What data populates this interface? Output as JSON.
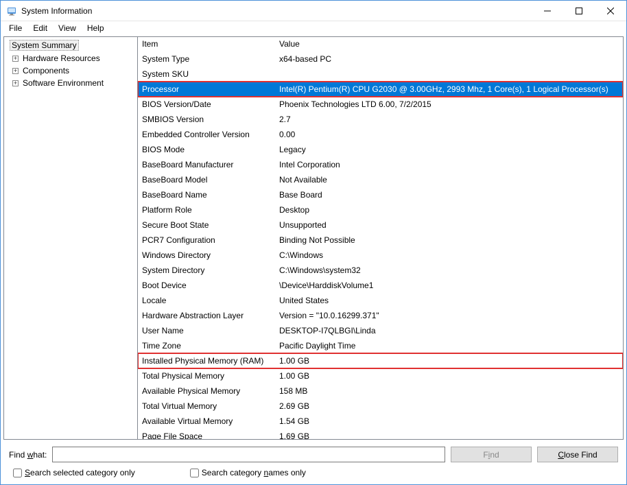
{
  "window": {
    "title": "System Information"
  },
  "menu": {
    "file": "File",
    "edit": "Edit",
    "view": "View",
    "help": "Help"
  },
  "tree": {
    "summary": "System Summary",
    "hardware": "Hardware Resources",
    "components": "Components",
    "software": "Software Environment"
  },
  "list": {
    "header_item": "Item",
    "header_value": "Value",
    "rows": [
      {
        "item": "System Type",
        "value": "x64-based PC"
      },
      {
        "item": "System SKU",
        "value": ""
      },
      {
        "item": "Processor",
        "value": "Intel(R) Pentium(R) CPU G2030 @ 3.00GHz, 2993 Mhz, 1 Core(s), 1 Logical Processor(s)"
      },
      {
        "item": "BIOS Version/Date",
        "value": "Phoenix Technologies LTD 6.00, 7/2/2015"
      },
      {
        "item": "SMBIOS Version",
        "value": "2.7"
      },
      {
        "item": "Embedded Controller Version",
        "value": "0.00"
      },
      {
        "item": "BIOS Mode",
        "value": "Legacy"
      },
      {
        "item": "BaseBoard Manufacturer",
        "value": "Intel Corporation"
      },
      {
        "item": "BaseBoard Model",
        "value": "Not Available"
      },
      {
        "item": "BaseBoard Name",
        "value": "Base Board"
      },
      {
        "item": "Platform Role",
        "value": "Desktop"
      },
      {
        "item": "Secure Boot State",
        "value": "Unsupported"
      },
      {
        "item": "PCR7 Configuration",
        "value": "Binding Not Possible"
      },
      {
        "item": "Windows Directory",
        "value": "C:\\Windows"
      },
      {
        "item": "System Directory",
        "value": "C:\\Windows\\system32"
      },
      {
        "item": "Boot Device",
        "value": "\\Device\\HarddiskVolume1"
      },
      {
        "item": "Locale",
        "value": "United States"
      },
      {
        "item": "Hardware Abstraction Layer",
        "value": "Version = \"10.0.16299.371\""
      },
      {
        "item": "User Name",
        "value": "DESKTOP-I7QLBGI\\Linda"
      },
      {
        "item": "Time Zone",
        "value": "Pacific Daylight Time"
      },
      {
        "item": "Installed Physical Memory (RAM)",
        "value": "1.00 GB"
      },
      {
        "item": "Total Physical Memory",
        "value": "1.00 GB"
      },
      {
        "item": "Available Physical Memory",
        "value": "158 MB"
      },
      {
        "item": "Total Virtual Memory",
        "value": "2.69 GB"
      },
      {
        "item": "Available Virtual Memory",
        "value": "1.54 GB"
      },
      {
        "item": "Page File Space",
        "value": "1.69 GB"
      }
    ],
    "selected_index": 2,
    "highlight_indices": [
      2,
      20
    ]
  },
  "find": {
    "label_prefix": "Find ",
    "label_underline": "w",
    "label_suffix": "hat:",
    "find_btn_prefix": "F",
    "find_btn_underline": "i",
    "find_btn_suffix": "nd",
    "close_btn_prefix": "",
    "close_btn_underline": "C",
    "close_btn_suffix": "lose Find",
    "chk1_prefix": "",
    "chk1_underline": "S",
    "chk1_suffix": "earch selected category only",
    "chk2_prefix": "Search category ",
    "chk2_underline": "n",
    "chk2_suffix": "ames only"
  }
}
